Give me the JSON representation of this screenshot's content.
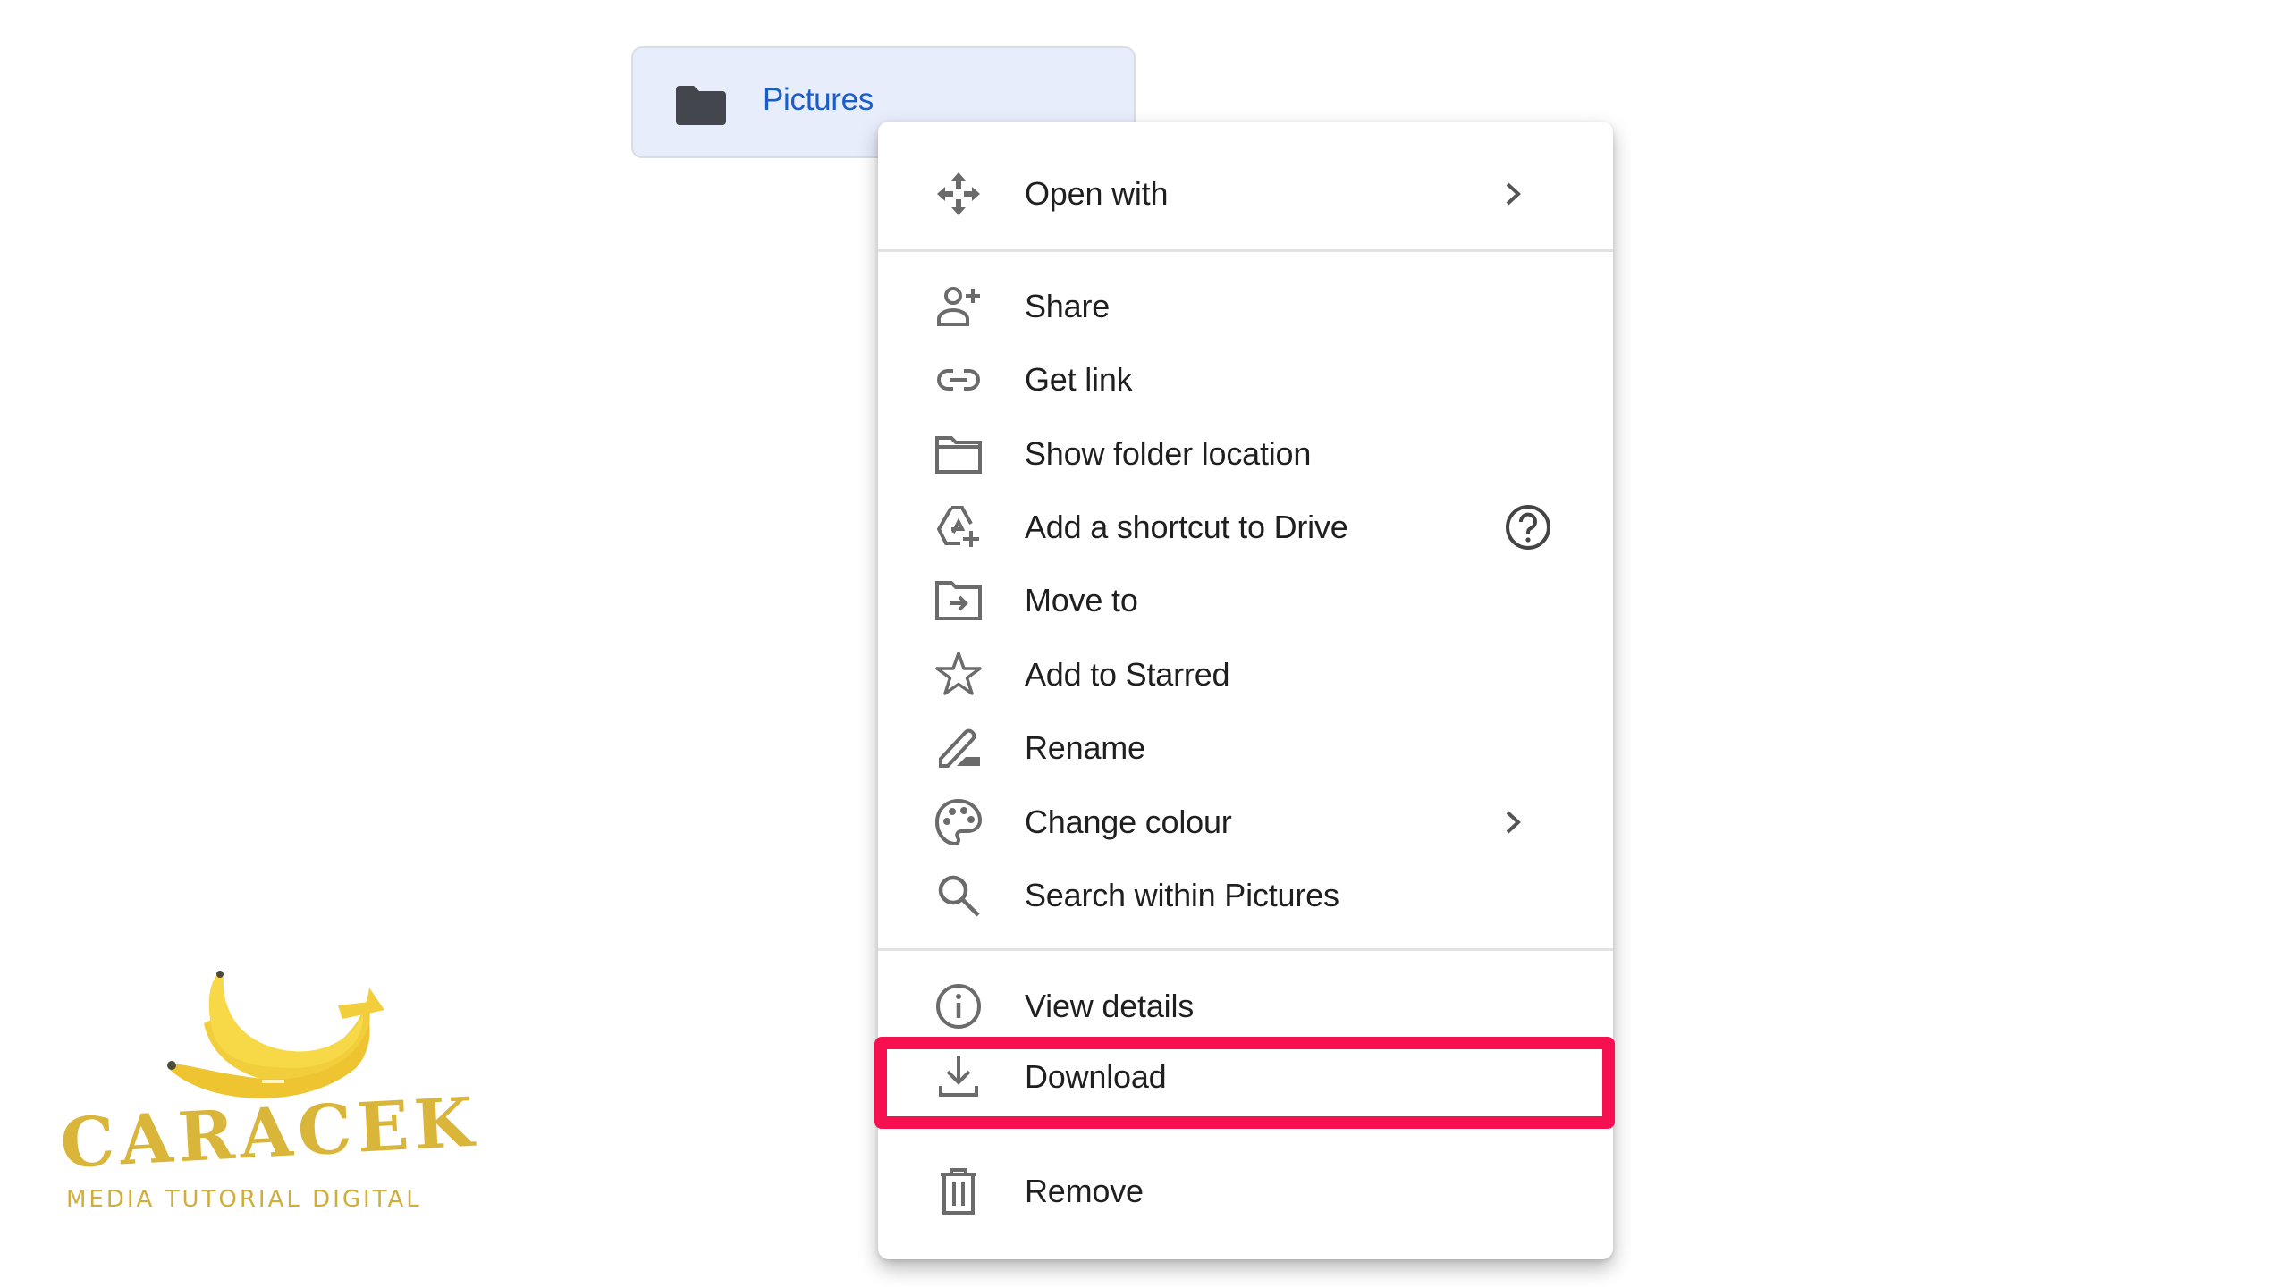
{
  "folder_chip": {
    "icon": "folder-icon",
    "label": "Pictures"
  },
  "context_menu": {
    "groups": [
      [
        {
          "label": "Open with",
          "icon": "open-with-icon",
          "submenu": true
        }
      ],
      [
        {
          "label": "Share",
          "icon": "person-add-icon"
        },
        {
          "label": "Get link",
          "icon": "link-icon"
        },
        {
          "label": "Show folder location",
          "icon": "folder-outline-icon"
        },
        {
          "label": "Add a shortcut to Drive",
          "icon": "drive-shortcut-icon",
          "help": true
        },
        {
          "label": "Move to",
          "icon": "move-to-folder-icon"
        },
        {
          "label": "Add to Starred",
          "icon": "star-icon"
        },
        {
          "label": "Rename",
          "icon": "pencil-icon"
        },
        {
          "label": "Change colour",
          "icon": "palette-icon",
          "submenu": true
        },
        {
          "label": "Search within Pictures",
          "icon": "search-icon"
        }
      ],
      [
        {
          "label": "View details",
          "icon": "info-icon"
        },
        {
          "label": "Download",
          "icon": "download-icon",
          "highlighted": true
        },
        {
          "label": "Remove",
          "icon": "trash-icon"
        }
      ]
    ]
  },
  "highlight": {
    "target": "Download",
    "color": "#f7104f"
  },
  "watermark": {
    "title": "CARACEK",
    "subtitle": "MEDIA TUTORIAL DIGITAL",
    "icon": "banana-icon"
  },
  "colors": {
    "chip_bg": "#e8edfc",
    "chip_text": "#1a5dc8",
    "icon_gray": "#5f6368",
    "text": "#1f1f1f"
  }
}
